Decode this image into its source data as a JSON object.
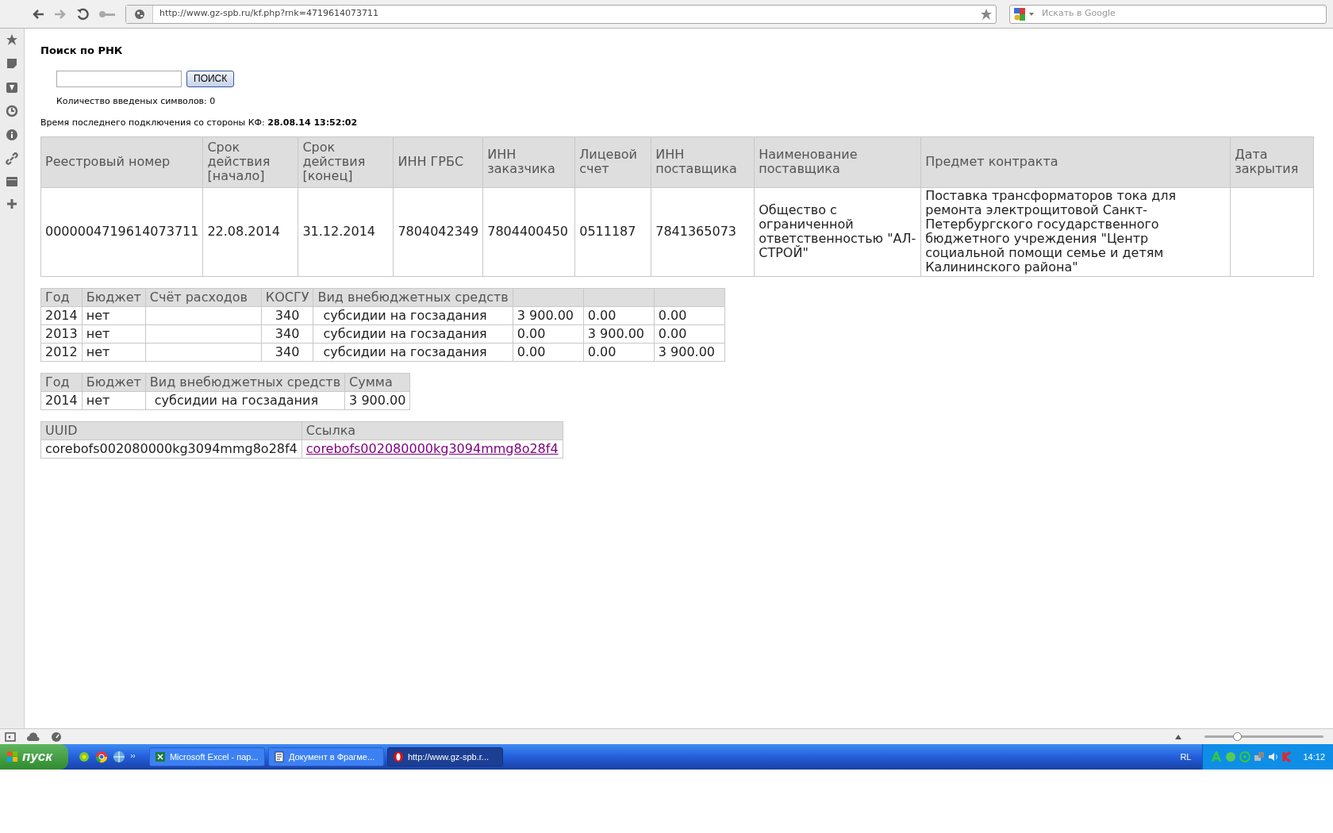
{
  "browser": {
    "url": "http://www.gz-spb.ru/kf.php?rnk=4719614073711",
    "search_placeholder": "Искать в Google",
    "zoom_slider": {
      "level": 0.27
    }
  },
  "page": {
    "title": "Поиск по РНК",
    "search_button": "ПОИСК",
    "counter_text": "Количество введеных символов: 0",
    "last_connection_label": "Время последнего подключения со стороны КФ:",
    "last_connection_value": "28.08.14 13:52:02"
  },
  "contract_table": {
    "columns": [
      "Реестровый номер",
      "Срок действия [начало]",
      "Срок действия [конец]",
      "ИНН ГРБС",
      "ИНН заказчика",
      "Лицевой счет",
      "ИНН поставщика",
      "Наименование поставщика",
      "Предмет контракта",
      "Дата закрытия"
    ],
    "rows": [
      [
        "0000004719614073711",
        "22.08.2014",
        "31.12.2014",
        "7804042349",
        "7804400450",
        "0511187",
        "7841365073",
        "Общество с ограниченной ответственностью \"АЛ-СТРОЙ\"",
        "Поставка трансформаторов тока для ремонта электрощитовой Санкт-Петербургского государственного бюджетного учреждения \"Центр социальной помощи семье и детям Калининского района\"",
        ""
      ]
    ]
  },
  "budget_table": {
    "columns": [
      "Год",
      "Бюджет",
      "Счёт расходов",
      "КОСГУ",
      "Вид внебюджетных средств",
      "",
      "",
      ""
    ],
    "rows": [
      [
        "2014",
        "нет",
        "",
        "340",
        "субсидии на госзадания",
        "3 900.00",
        "0.00",
        "0.00"
      ],
      [
        "2013",
        "нет",
        "",
        "340",
        "субсидии на госзадания",
        "0.00",
        "3 900.00",
        "0.00"
      ],
      [
        "2012",
        "нет",
        "",
        "340",
        "субсидии на госзадания",
        "0.00",
        "0.00",
        "3 900.00"
      ]
    ]
  },
  "finance_table": {
    "columns": [
      "Год",
      "Бюджет",
      "Вид внебюджетных средств",
      "Сумма"
    ],
    "rows": [
      [
        "2014",
        "нет",
        "субсидии на госзадания",
        "3 900.00"
      ]
    ]
  },
  "uuid_table": {
    "columns": [
      "UUID",
      "Ссылка"
    ],
    "rows": [
      [
        {
          "kind": "text",
          "text": "corebofs002080000kg3094mmg8o28f4"
        },
        {
          "kind": "link",
          "text": "corebofs002080000kg3094mmg8o28f4"
        }
      ]
    ]
  },
  "taskbar": {
    "start": "пуск",
    "tasks": [
      {
        "label": "Microsoft Excel - пар...",
        "kind": "excel",
        "selected": false
      },
      {
        "label": "Документ в Фрагме...",
        "kind": "document",
        "selected": false
      },
      {
        "label": "http://www.gz-spb.r...",
        "kind": "browser",
        "selected": true
      }
    ],
    "language": "RL",
    "clock": "14:12"
  }
}
